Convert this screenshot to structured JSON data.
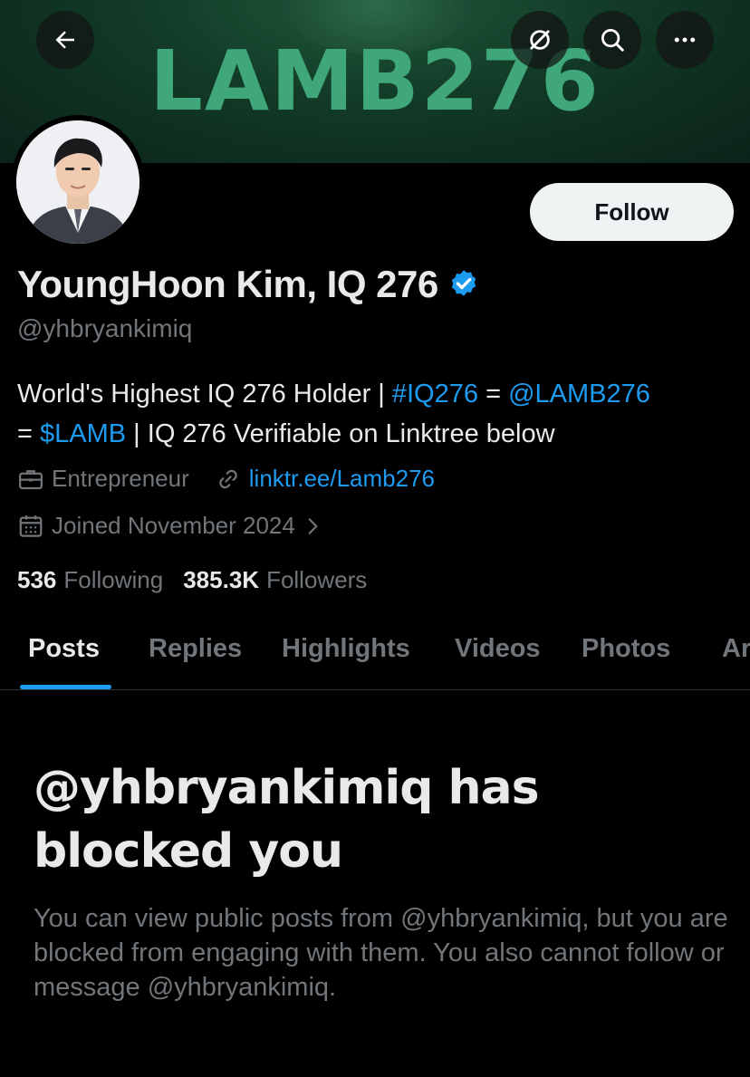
{
  "banner": {
    "text": "LAMB276"
  },
  "profile": {
    "display_name": "YoungHoon Kim, IQ 276",
    "handle": "@yhbryankimiq",
    "follow_label": "Follow",
    "bio": {
      "line1_text": "World's Highest IQ 276 Holder | ",
      "hashtag": "#IQ276",
      "equals1": " = ",
      "mention": "@LAMB276",
      "equals2": "= ",
      "cashtag": "$LAMB",
      "line2_rest": " | IQ 276 Verifiable on Linktree below"
    },
    "category": "Entrepreneur",
    "website": "linktr.ee/Lamb276",
    "joined": "Joined November 2024",
    "following_count": "536",
    "following_label": "Following",
    "followers_count": "385.3K",
    "followers_label": "Followers"
  },
  "tabs": [
    {
      "label": "Posts",
      "active": true
    },
    {
      "label": "Replies"
    },
    {
      "label": "Highlights"
    },
    {
      "label": "Videos"
    },
    {
      "label": "Photos"
    },
    {
      "label": "Ar"
    }
  ],
  "blocked": {
    "title": "@yhbryankimiq has blocked you",
    "body": "You can view public posts from @yhbryankimiq, but you are blocked from engaging with them. You also cannot follow or message @yhbryankimiq."
  },
  "icons": {
    "back": "arrow-left-icon",
    "dismiss": "dismiss-grok-icon",
    "search": "search-icon",
    "more": "more-horizontal-icon",
    "verified": "verified-badge-icon",
    "briefcase": "briefcase-icon",
    "link": "link-icon",
    "calendar": "calendar-icon",
    "chevron": "chevron-right-icon"
  },
  "colors": {
    "accent": "#1d9bf0",
    "banner_text": "#3fa77a",
    "background": "#000000",
    "muted": "#71767b"
  }
}
